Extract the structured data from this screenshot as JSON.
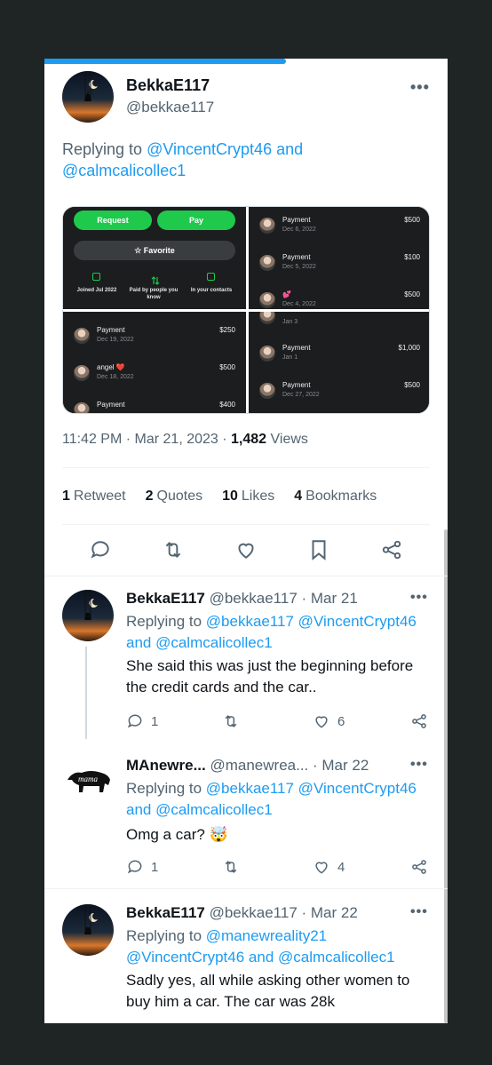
{
  "main_tweet": {
    "author_name": "BekkaE117",
    "author_handle": "@bekkae117",
    "replying_prefix": "Replying to ",
    "replying_user1": "@VincentCrypt46",
    "replying_and": " and ",
    "replying_user2": "@calmcalicollec1",
    "timestamp": "11:42 PM · Mar 21, 2023 · ",
    "views_count": "1,482",
    "views_label": " Views",
    "load_progress": 0.6
  },
  "media": {
    "request_label": "Request",
    "pay_label": "Pay",
    "favorite_label": "☆ Favorite",
    "info1": "Joined Jul 2022",
    "info2": "Paid by people you know",
    "info3": "In your contacts",
    "panel_tr": [
      {
        "title": "Payment",
        "date": "Dec 6, 2022",
        "amount": "$500"
      },
      {
        "title": "Payment",
        "date": "Dec 5, 2022",
        "amount": "$100"
      },
      {
        "title": "💕",
        "date": "Dec 4, 2022",
        "amount": "$500"
      }
    ],
    "panel_bl": [
      {
        "title": "Payment",
        "date": "Dec 19, 2022",
        "amount": "$250"
      },
      {
        "title": "angel ❤️",
        "date": "Dec 18, 2022",
        "amount": "$500"
      },
      {
        "title": "Payment",
        "date": "",
        "amount": "$400"
      }
    ],
    "panel_br": [
      {
        "title": "Jan 3",
        "date": "",
        "amount": ""
      },
      {
        "title": "Payment",
        "date": "Jan 1",
        "amount": "$1,000"
      },
      {
        "title": "Payment",
        "date": "Dec 27, 2022",
        "amount": "$500"
      }
    ]
  },
  "stats": {
    "retweets_count": "1",
    "retweets_label": "Retweet",
    "quotes_count": "2",
    "quotes_label": "Quotes",
    "likes_count": "10",
    "likes_label": "Likes",
    "bookmarks_count": "4",
    "bookmarks_label": "Bookmarks"
  },
  "replies": [
    {
      "name": "BekkaE117",
      "handle_date": " @bekkae117 · Mar 21",
      "replying_prefix": "Replying to ",
      "replying_users": "@bekkae117 @VincentCrypt46",
      "replying_and": " and ",
      "replying_last": "@calmcalicollec1",
      "text": "She said this was just the beginning before the credit cards and the car..",
      "reply_count": "1",
      "retweet_count": "",
      "like_count": "6"
    },
    {
      "name": "MAnewre...",
      "handle_date": "  @manewrea...  · Mar 22",
      "replying_prefix": "Replying to ",
      "replying_users": "@bekkae117 @VincentCrypt46",
      "replying_and": " and ",
      "replying_last": "@calmcalicollec1",
      "text": "Omg a car? 🤯",
      "reply_count": "1",
      "retweet_count": "",
      "like_count": "4"
    },
    {
      "name": "BekkaE117",
      "handle_date": " @bekkae117 · Mar 22",
      "replying_prefix": "Replying to ",
      "replying_users": "@manewreality21",
      "replying_users2": "@VincentCrypt46",
      "replying_and": " and ",
      "replying_last": "@calmcalicollec1",
      "text": "Sadly yes, all while asking other women to buy him a car. The car was 28k"
    }
  ],
  "more_label": "•••",
  "mama_logo_text": "mama"
}
